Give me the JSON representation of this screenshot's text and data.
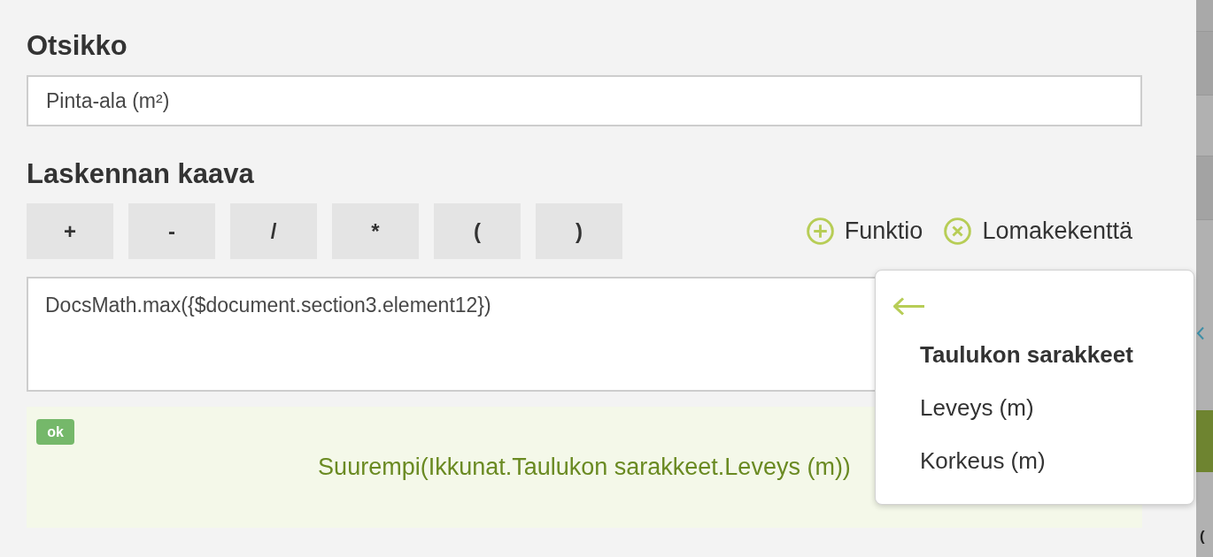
{
  "title_field": {
    "label": "Otsikko",
    "value": "Pinta-ala (m²)"
  },
  "formula": {
    "label": "Laskennan kaava",
    "operators": [
      "+",
      "-",
      "/",
      "*",
      "(",
      ")"
    ],
    "links": [
      {
        "kind": "add",
        "label": "Funktio"
      },
      {
        "kind": "remove",
        "label": "Lomakekenttä"
      }
    ],
    "value": "DocsMath.max({$document.section3.element12})"
  },
  "result": {
    "badge": "ok",
    "text": "Suurempi(Ikkunat.Taulukon sarakkeet.Leveys (m))"
  },
  "dropdown": {
    "heading": "Taulukon sarakkeet",
    "items": [
      "Leveys (m)",
      "Korkeus (m)"
    ]
  },
  "background_page": {
    "text": "("
  }
}
